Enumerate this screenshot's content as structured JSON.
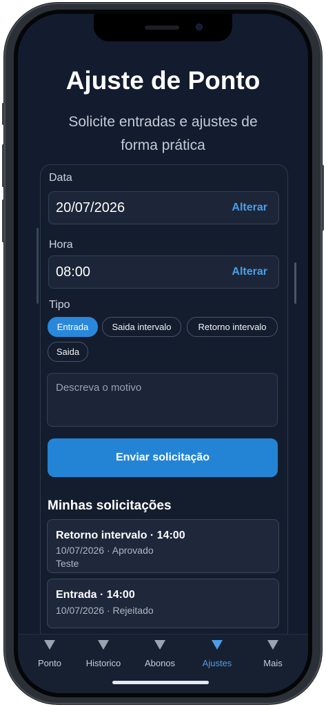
{
  "header": {
    "title": "Ajuste de Ponto",
    "subtitle": "Solicite entradas e ajustes de forma prática"
  },
  "form": {
    "date_label": "Data",
    "date_value": "20/07/2026",
    "date_action": "Alterar",
    "time_label": "Hora",
    "time_value": "08:00",
    "time_action": "Alterar",
    "type_label": "Tipo",
    "types": [
      "Entrada",
      "Saida intervalo",
      "Retorno intervalo",
      "Saida"
    ],
    "selected_type": "Entrada",
    "reason_placeholder": "Descreva o motivo",
    "submit_label": "Enviar solicitação"
  },
  "requests": {
    "title": "Minhas solicitações",
    "items": [
      {
        "title": "Retorno intervalo · 14:00",
        "meta": "10/07/2026 · Aprovado",
        "note": "Teste"
      },
      {
        "title": "Entrada · 14:00",
        "meta": "10/07/2026 · Rejeitado",
        "note": ""
      }
    ]
  },
  "tabbar": {
    "items": [
      {
        "label": "Ponto",
        "icon": "triangle-down-icon"
      },
      {
        "label": "Historico",
        "icon": "triangle-down-icon"
      },
      {
        "label": "Abonos",
        "icon": "triangle-down-icon"
      },
      {
        "label": "Ajustes",
        "icon": "triangle-down-icon"
      },
      {
        "label": "Mais",
        "icon": "triangle-down-icon"
      }
    ],
    "active": "Ajustes"
  },
  "colors": {
    "background": "#131c2e",
    "accent": "#2384d6",
    "link": "#4d9de8"
  }
}
